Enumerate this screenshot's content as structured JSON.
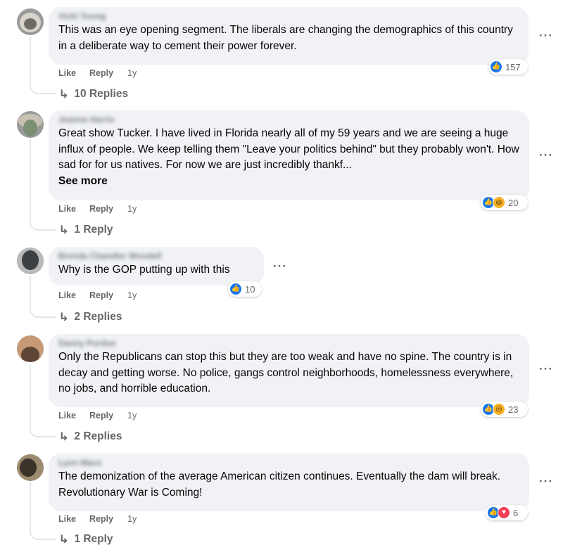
{
  "more_options_glyph": "···",
  "comments": [
    {
      "author": "Vicki Young",
      "text": "This was an eye opening segment. The liberals are changing the demographics of this country in a deliberate way to cement their power forever.",
      "see_more": "",
      "reactions": [
        "like"
      ],
      "reaction_count": "157",
      "like_label": "Like",
      "reply_label": "Reply",
      "time": "1y",
      "replies_label": "10 Replies",
      "avatar_colors": [
        "#6f6a62",
        "#d8d4cc"
      ]
    },
    {
      "author": "Jeanne Harris",
      "text": "Great show Tucker. I have lived in Florida nearly all of my 59 years and we are seeing a huge influx of people. We keep telling them \"Leave your politics behind\" but they probably won't. How sad for for us natives. For now we are just incredibly thankf...",
      "see_more": "See more",
      "reactions": [
        "like",
        "haha"
      ],
      "reaction_count": "20",
      "like_label": "Like",
      "reply_label": "Reply",
      "time": "1y",
      "replies_label": "1 Reply",
      "avatar_colors": [
        "#7d8f73",
        "#c9c2b3"
      ]
    },
    {
      "author": "Brenda Chandler Woodell",
      "text": "Why is the GOP putting up with this",
      "see_more": "",
      "reactions": [
        "like"
      ],
      "reaction_count": "10",
      "like_label": "Like",
      "reply_label": "Reply",
      "time": "1y",
      "replies_label": "2 Replies",
      "avatar_colors": [
        "#3c3f44",
        "#b9b9b9"
      ]
    },
    {
      "author": "Danny Purdue",
      "text": "Only the Republicans can stop this but they are too weak and have no spine. The country is in decay and getting worse. No police, gangs control neighborhoods, homelessness everywhere, no jobs, and horrible education.",
      "see_more": "",
      "reactions": [
        "like",
        "sad"
      ],
      "reaction_count": "23",
      "like_label": "Like",
      "reply_label": "Reply",
      "time": "1y",
      "replies_label": "2 Replies",
      "avatar_colors": [
        "#5d4636",
        "#c69a76"
      ]
    },
    {
      "author": "Lynn Mace",
      "text": "The demonization of the average American citizen continues. Eventually the dam will break. Revolutionary War is Coming!",
      "see_more": "",
      "reactions": [
        "like",
        "love"
      ],
      "reaction_count": "6",
      "like_label": "Like",
      "reply_label": "Reply",
      "time": "1y",
      "replies_label": "1 Reply",
      "avatar_colors": [
        "#3a332a",
        "#9e8a6e"
      ]
    }
  ],
  "icons": {
    "like": "thumbs-up-icon",
    "haha": "haha-icon",
    "sad": "sad-icon",
    "love": "heart-icon",
    "reply_arrow": "reply-arrow-icon",
    "more": "more-options-icon"
  },
  "colors": {
    "like": "#1877f2",
    "love": "#f33e58",
    "haha": "#f7b125",
    "bubble": "#f0f2f5",
    "secondary_text": "#65676b"
  }
}
